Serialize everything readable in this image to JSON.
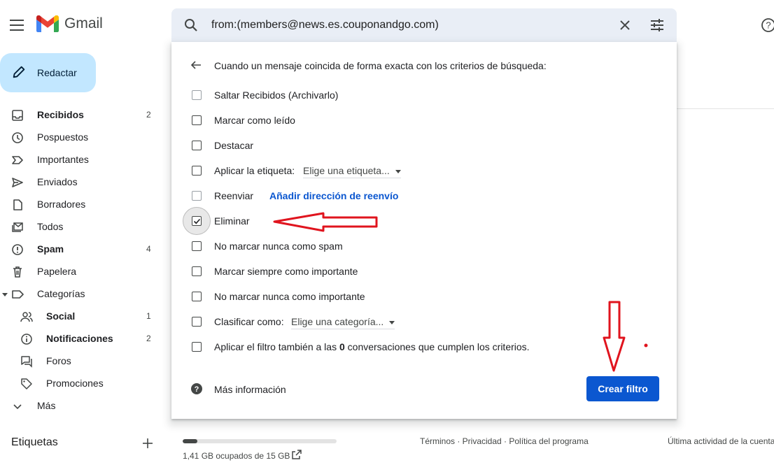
{
  "app": {
    "name": "Gmail"
  },
  "search": {
    "query": "from:(members@news.es.couponandgo.com)"
  },
  "compose": {
    "label": "Redactar"
  },
  "sidebar": {
    "items": [
      {
        "label": "Recibidos",
        "count": "2",
        "icon": "inbox-icon"
      },
      {
        "label": "Pospuestos",
        "count": "",
        "icon": "clock-icon"
      },
      {
        "label": "Importantes",
        "count": "",
        "icon": "important-icon"
      },
      {
        "label": "Enviados",
        "count": "",
        "icon": "send-icon"
      },
      {
        "label": "Borradores",
        "count": "",
        "icon": "draft-icon"
      },
      {
        "label": "Todos",
        "count": "",
        "icon": "all-mail-icon"
      },
      {
        "label": "Spam",
        "count": "4",
        "icon": "spam-icon"
      },
      {
        "label": "Papelera",
        "count": "",
        "icon": "trash-icon"
      },
      {
        "label": "Categorías",
        "count": "",
        "icon": "label-icon"
      },
      {
        "label": "Social",
        "count": "1",
        "icon": "people-icon"
      },
      {
        "label": "Notificaciones",
        "count": "2",
        "icon": "info-icon"
      },
      {
        "label": "Foros",
        "count": "",
        "icon": "forum-icon"
      },
      {
        "label": "Promociones",
        "count": "",
        "icon": "tag-icon"
      },
      {
        "label": "Más",
        "count": "",
        "icon": "chevron-down-icon"
      }
    ],
    "labels_heading": "Etiquetas"
  },
  "filter": {
    "heading": "Cuando un mensaje coincida de forma exacta con los criterios de búsqueda:",
    "options": {
      "skip_inbox": {
        "label": "Saltar Recibidos (Archivarlo)",
        "checked": false
      },
      "mark_read": {
        "label": "Marcar como leído",
        "checked": false
      },
      "star": {
        "label": "Destacar",
        "checked": false
      },
      "apply_label": {
        "label": "Aplicar la etiqueta:",
        "dropdown": "Elige una etiqueta...",
        "checked": false
      },
      "forward": {
        "label": "Reenviar",
        "link": "Añadir dirección de reenvío",
        "checked": false
      },
      "delete": {
        "label": "Eliminar",
        "checked": true
      },
      "never_spam": {
        "label": "No marcar nunca como spam",
        "checked": false
      },
      "always_important": {
        "label": "Marcar siempre como importante",
        "checked": false
      },
      "never_important": {
        "label": "No marcar nunca como importante",
        "checked": false
      },
      "categorize": {
        "label": "Clasificar como:",
        "dropdown": "Elige una categoría...",
        "checked": false
      },
      "apply_existing": {
        "prefix": "Aplicar el filtro también a las ",
        "count": "0",
        "suffix": " conversaciones que cumplen los criterios.",
        "checked": false
      }
    },
    "more_info": "Más información",
    "create_button": "Crear filtro"
  },
  "footer": {
    "storage": "1,41 GB ocupados de 15 GB",
    "storage_used_fraction": 0.094,
    "links": "Términos · Privacidad · Política del programa",
    "last_activity": "Última actividad de la cuenta"
  },
  "colors": {
    "compose_bg": "#c2e7ff",
    "search_bg": "#e9eef6",
    "primary_button": "#0b57d0",
    "link": "#0b57d0",
    "annotation": "#e0141e"
  }
}
